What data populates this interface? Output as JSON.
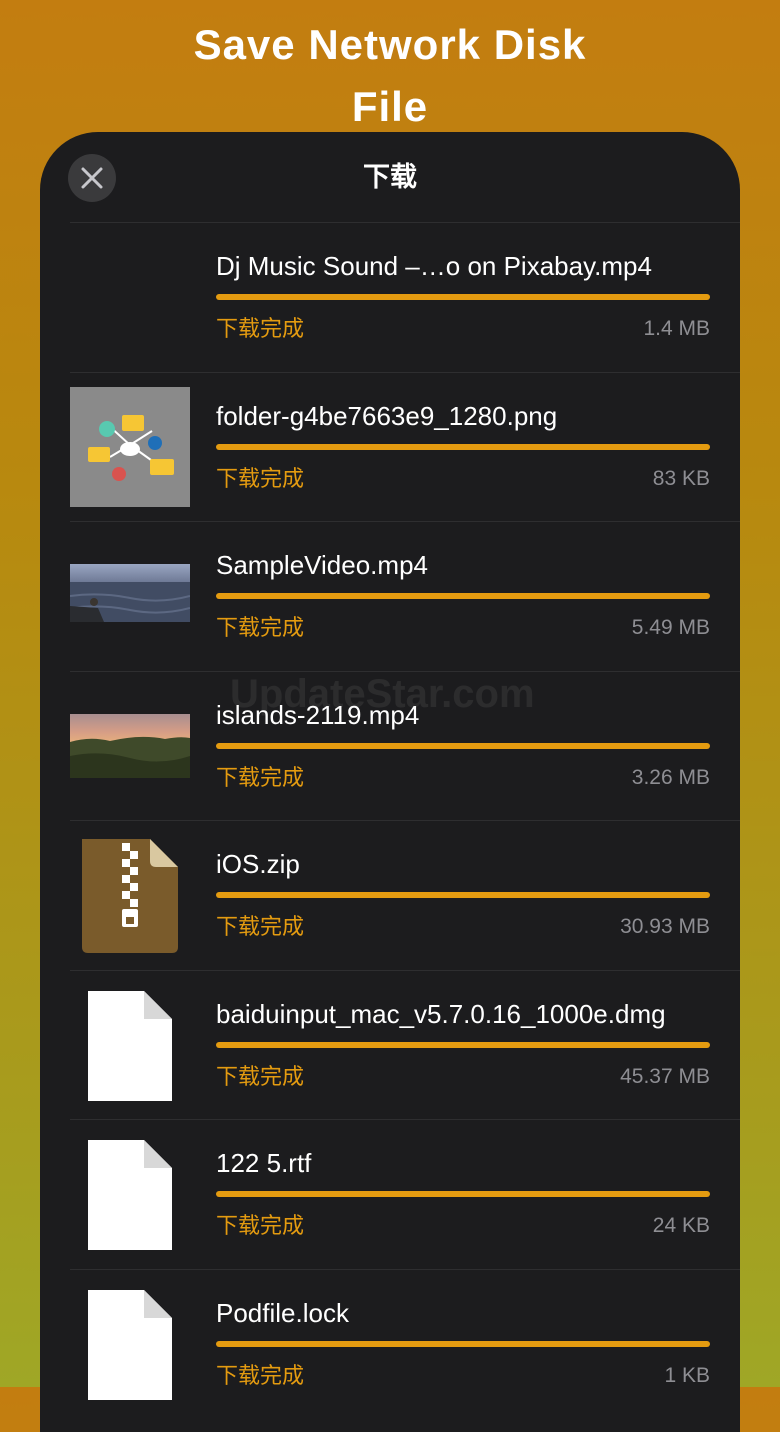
{
  "promo": {
    "title_line1": "Save Network Disk",
    "title_line2": "File"
  },
  "header": {
    "title": "下载",
    "close_icon": "close-icon"
  },
  "watermark": "UpdateStar.com",
  "colors": {
    "accent": "#e49b10",
    "panel_bg": "#1c1c1e",
    "size_text": "#8e8e93"
  },
  "files": [
    {
      "name": "Dj Music Sound –…o on Pixabay.mp4",
      "status": "下载完成",
      "size": "1.4 MB",
      "progress": 1.0,
      "thumb": "none"
    },
    {
      "name": "folder-g4be7663e9_1280.png",
      "status": "下载完成",
      "size": "83 KB",
      "progress": 1.0,
      "thumb": "folder-network-image"
    },
    {
      "name": "SampleVideo.mp4",
      "status": "下载完成",
      "size": "5.49 MB",
      "progress": 1.0,
      "thumb": "sea-video-frame"
    },
    {
      "name": "islands-2119.mp4",
      "status": "下载完成",
      "size": "3.26 MB",
      "progress": 1.0,
      "thumb": "sunset-video-frame"
    },
    {
      "name": "iOS.zip",
      "status": "下载完成",
      "size": "30.93 MB",
      "progress": 1.0,
      "thumb": "zip-file-icon"
    },
    {
      "name": "baiduinput_mac_v5.7.0.16_1000e.dmg",
      "status": "下载完成",
      "size": "45.37 MB",
      "progress": 1.0,
      "thumb": "document-icon"
    },
    {
      "name": "122 5.rtf",
      "status": "下载完成",
      "size": "24 KB",
      "progress": 1.0,
      "thumb": "document-icon"
    },
    {
      "name": "Podfile.lock",
      "status": "下载完成",
      "size": "1 KB",
      "progress": 1.0,
      "thumb": "document-icon"
    }
  ]
}
